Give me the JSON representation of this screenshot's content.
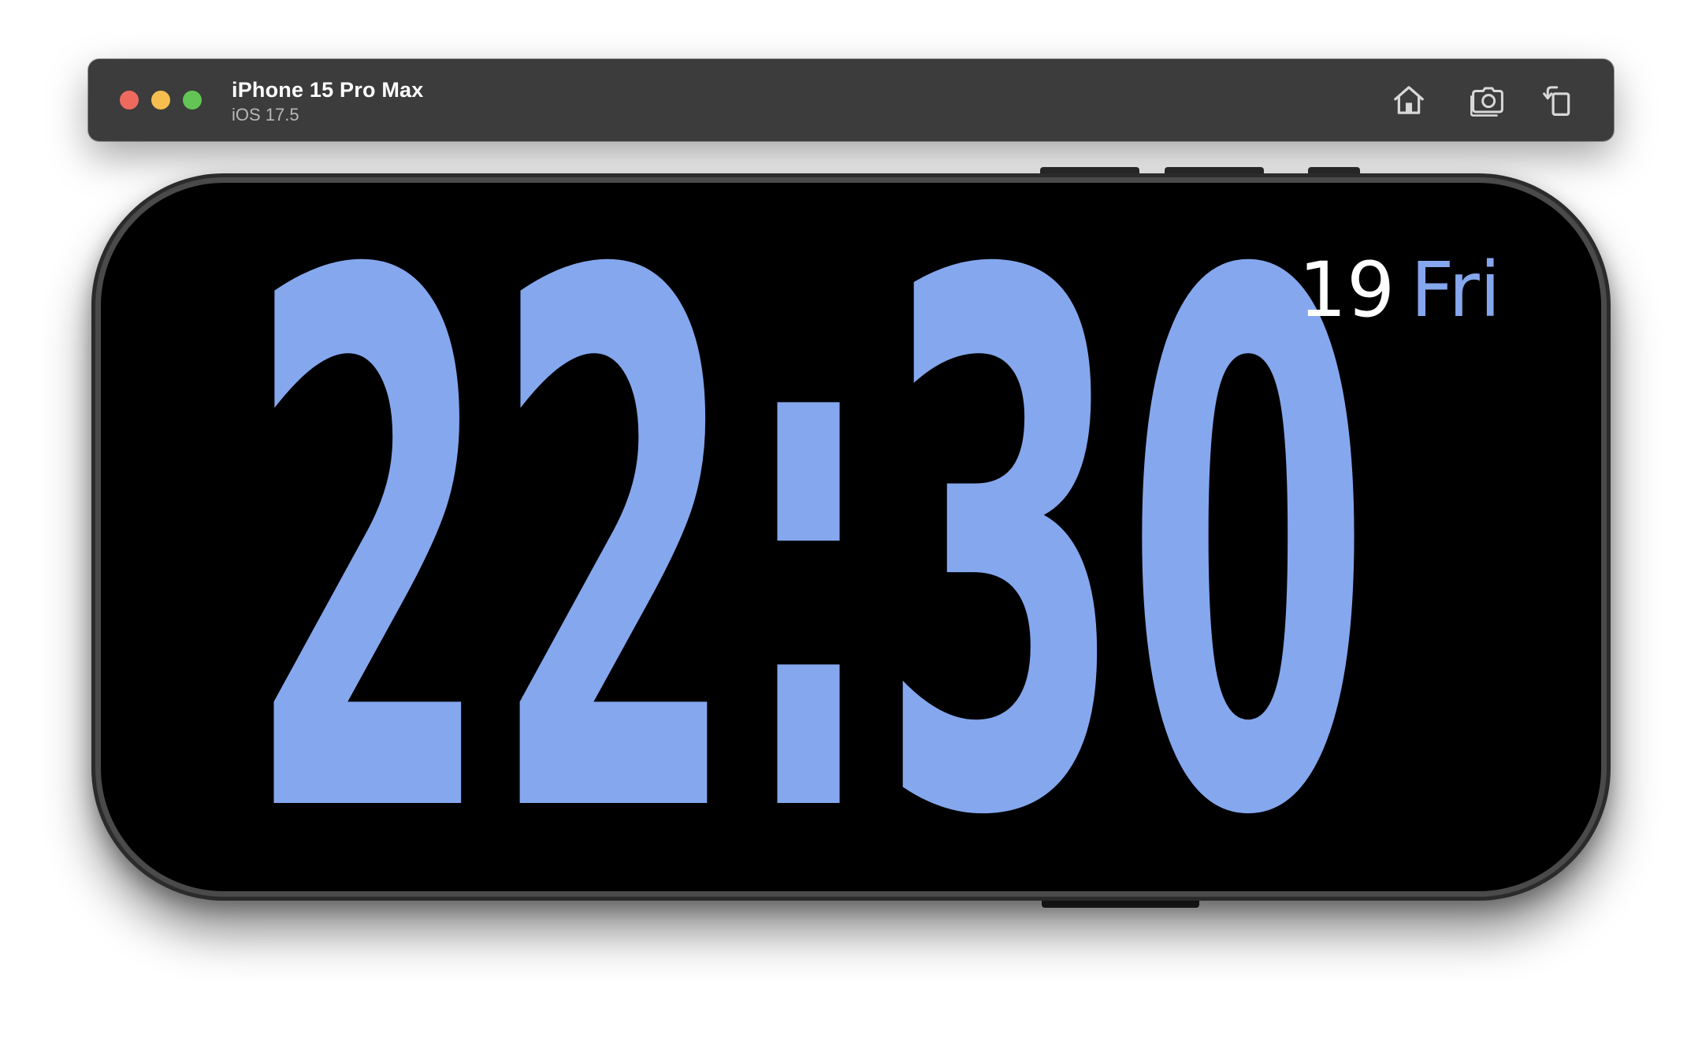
{
  "window": {
    "device_name": "iPhone 15 Pro Max",
    "os_version": "iOS 17.5",
    "traffic_lights": {
      "close_color": "#ee6a5f",
      "minimize_color": "#f5be4f",
      "zoom_color": "#62c554"
    },
    "toolbar": [
      {
        "name": "home",
        "icon": "home-icon"
      },
      {
        "name": "screenshot",
        "icon": "camera-icon"
      },
      {
        "name": "rotate",
        "icon": "rotate-icon"
      }
    ]
  },
  "standby": {
    "time": "22:30",
    "day": "19",
    "weekday": "Fri",
    "accent_color": "#85a7ee",
    "date_day_color": "#ffffff",
    "background_color": "#000000"
  }
}
